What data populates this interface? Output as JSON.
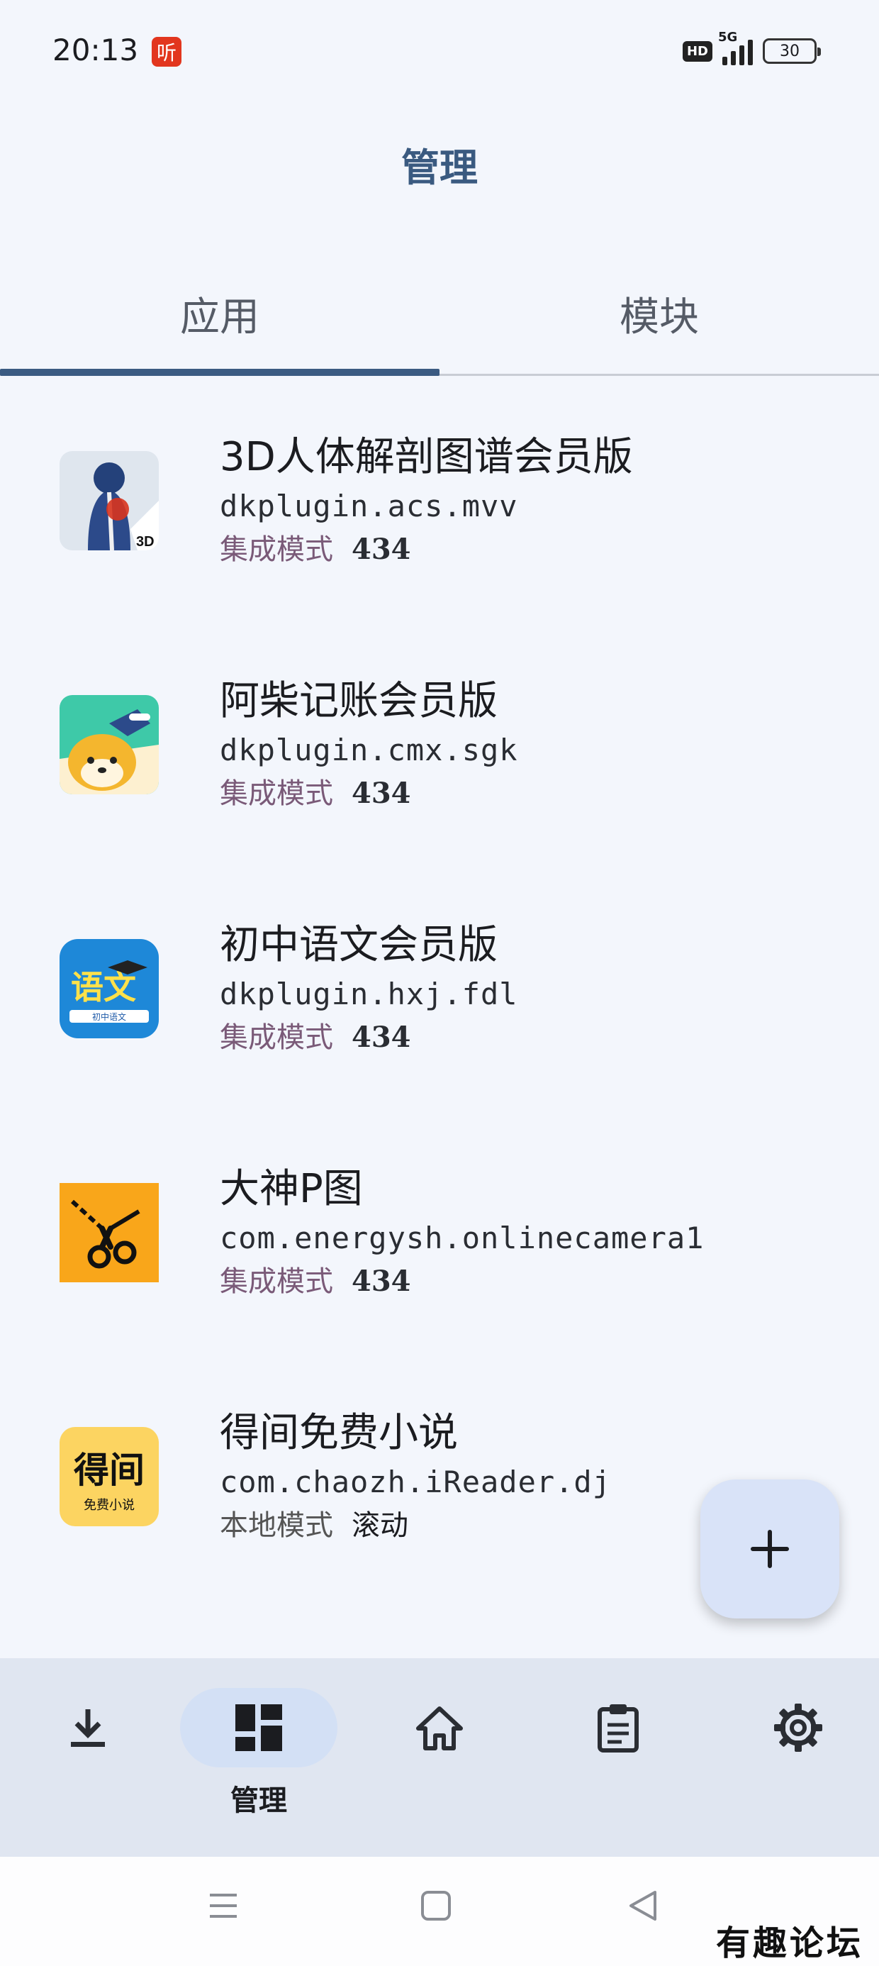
{
  "status_bar": {
    "time": "20:13",
    "app_badge": "听",
    "hd": "HD",
    "network": "5G",
    "battery": "30"
  },
  "header": {
    "title": "管理"
  },
  "tabs": [
    {
      "label": "应用",
      "selected": true
    },
    {
      "label": "模块",
      "selected": false
    }
  ],
  "apps": [
    {
      "name": "3D人体解剖图谱会员版",
      "package": "dkplugin.acs.mvv",
      "mode": "集成模式",
      "value": "434",
      "icon": "anatomy-3d-icon"
    },
    {
      "name": "阿柴记账会员版",
      "package": "dkplugin.cmx.sgk",
      "mode": "集成模式",
      "value": "434",
      "icon": "shiba-dog-icon"
    },
    {
      "name": "初中语文会员版",
      "package": "dkplugin.hxj.fdl",
      "mode": "集成模式",
      "value": "434",
      "icon": "chinese-language-icon"
    },
    {
      "name": "大神P图",
      "package": "com.energysh.onlinecamera1",
      "mode": "集成模式",
      "value": "434",
      "icon": "scissors-icon"
    },
    {
      "name": "得间免费小说",
      "package": "com.chaozh.iReader.dj",
      "mode": "本地模式",
      "value": "滚动",
      "icon": "novel-reader-icon"
    }
  ],
  "icon_texts": {
    "anatomy": "3D",
    "chinese_main": "语文",
    "chinese_sub": "初中语文",
    "novel_main": "得间",
    "novel_sub": "免费小说"
  },
  "fab": {
    "icon": "plus-icon"
  },
  "bottom_nav": [
    {
      "icon": "download-icon",
      "label": ""
    },
    {
      "icon": "dashboard-icon",
      "label": "管理",
      "selected": true
    },
    {
      "icon": "home-icon",
      "label": ""
    },
    {
      "icon": "clipboard-icon",
      "label": ""
    },
    {
      "icon": "gear-icon",
      "label": ""
    }
  ],
  "watermark": "有趣论坛",
  "colors": {
    "background": "#f3f6fc",
    "accent": "#3b5b82",
    "integrated_mode": "#7a5a78",
    "nav_background": "#e0e6f1",
    "fab_background": "#d9e3f8"
  }
}
